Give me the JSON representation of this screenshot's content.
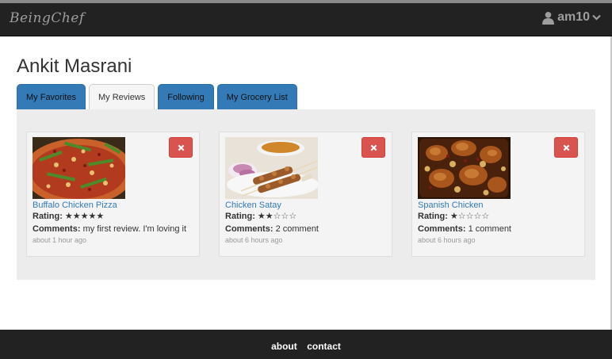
{
  "navbar": {
    "brand": "BeingChef",
    "username": "am10",
    "user_icon": "user-icon",
    "dropdown_icon": "chevron-down-icon"
  },
  "profile": {
    "name": "Ankit Masrani"
  },
  "tabs": [
    {
      "label": "My Favorites",
      "active": false
    },
    {
      "label": "My Reviews",
      "active": true
    },
    {
      "label": "Following",
      "active": false
    },
    {
      "label": "My Grocery List",
      "active": false
    }
  ],
  "reviews": [
    {
      "title": "Buffalo Chicken Pizza",
      "rating_label": "Rating:",
      "rating": 5,
      "max_rating": 5,
      "comments_label": "Comments:",
      "comments": "my first review. I'm loving it",
      "time": "about 1 hour ago",
      "delete_icon": "close-icon"
    },
    {
      "title": "Chicken Satay",
      "rating_label": "Rating:",
      "rating": 2,
      "max_rating": 5,
      "comments_label": "Comments:",
      "comments": "2 comment",
      "time": "about 6 hours ago",
      "delete_icon": "close-icon"
    },
    {
      "title": "Spanish Chicken",
      "rating_label": "Rating:",
      "rating": 1,
      "max_rating": 5,
      "comments_label": "Comments:",
      "comments": "1 comment",
      "time": "about 6 hours ago",
      "delete_icon": "close-icon"
    }
  ],
  "footer": {
    "about": "about",
    "contact": "contact"
  },
  "colors": {
    "navbar_bg": "#222222",
    "tab_blue": "#337ab7",
    "delete_red": "#d9534f",
    "link_blue": "#337ab7",
    "panel_bg": "#ececec"
  }
}
